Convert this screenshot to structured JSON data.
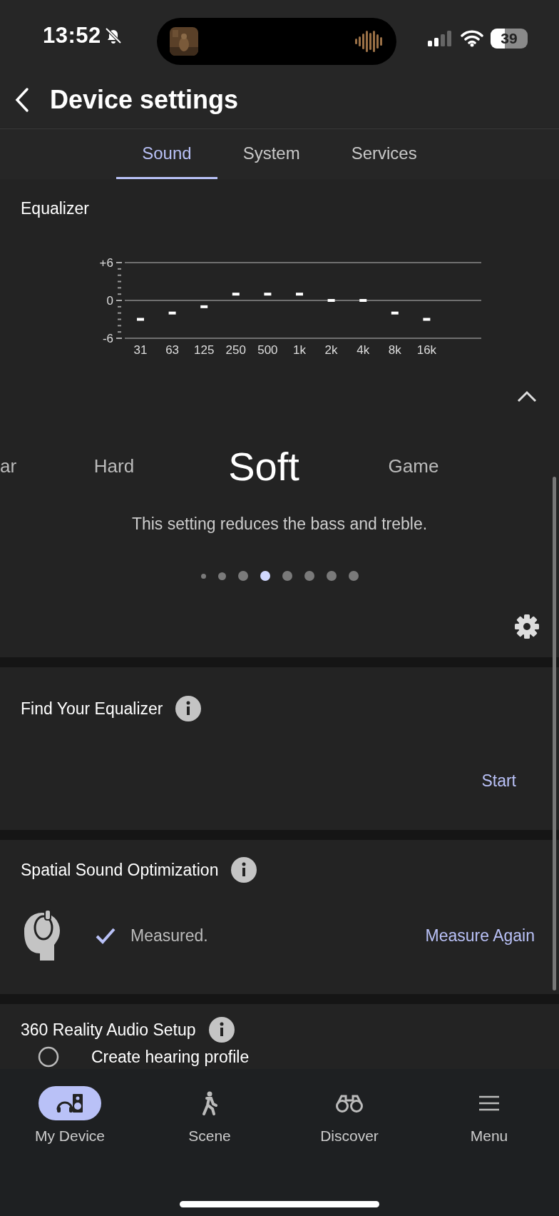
{
  "status_bar": {
    "time": "13:52",
    "battery": "39"
  },
  "header": {
    "title": "Device settings"
  },
  "tabs": [
    {
      "label": "Sound",
      "selected": true
    },
    {
      "label": "System",
      "selected": false
    },
    {
      "label": "Services",
      "selected": false
    }
  ],
  "equalizer": {
    "title": "Equalizer",
    "chart_data": {
      "type": "scatter",
      "categories": [
        "31",
        "63",
        "125",
        "250",
        "500",
        "1k",
        "2k",
        "4k",
        "8k",
        "16k"
      ],
      "values": [
        -3,
        -2,
        -1,
        1,
        1,
        1,
        0,
        0,
        -2,
        -3
      ],
      "ylim": [
        -6,
        6
      ],
      "yticks": [
        {
          "value": 6,
          "label": "+6"
        },
        0,
        -6
      ]
    },
    "presets": [
      {
        "label": "ar",
        "selected": false
      },
      {
        "label": "Hard",
        "selected": false
      },
      {
        "label": "Soft",
        "selected": true
      },
      {
        "label": "Game",
        "selected": false
      }
    ],
    "description": "This setting reduces the bass and treble.",
    "pages": [
      {
        "kind": "tiny",
        "selected": false
      },
      {
        "kind": "small",
        "selected": false
      },
      {
        "kind": "full",
        "selected": false
      },
      {
        "kind": "full",
        "selected": true
      },
      {
        "kind": "full",
        "selected": false
      },
      {
        "kind": "full",
        "selected": false
      },
      {
        "kind": "full",
        "selected": false
      },
      {
        "kind": "full",
        "selected": false
      }
    ]
  },
  "find_equalizer": {
    "title": "Find Your Equalizer",
    "action": "Start"
  },
  "spatial_sound": {
    "title": "Spatial Sound Optimization",
    "status": "Measured.",
    "measured": true,
    "action": "Measure Again"
  },
  "reality_audio": {
    "title": "360 Reality Audio Setup",
    "step": "Create hearing profile"
  },
  "bottom_nav": [
    {
      "label": "My Device",
      "selected": true
    },
    {
      "label": "Scene",
      "selected": false
    },
    {
      "label": "Discover",
      "selected": false
    },
    {
      "label": "Menu",
      "selected": false
    }
  ]
}
